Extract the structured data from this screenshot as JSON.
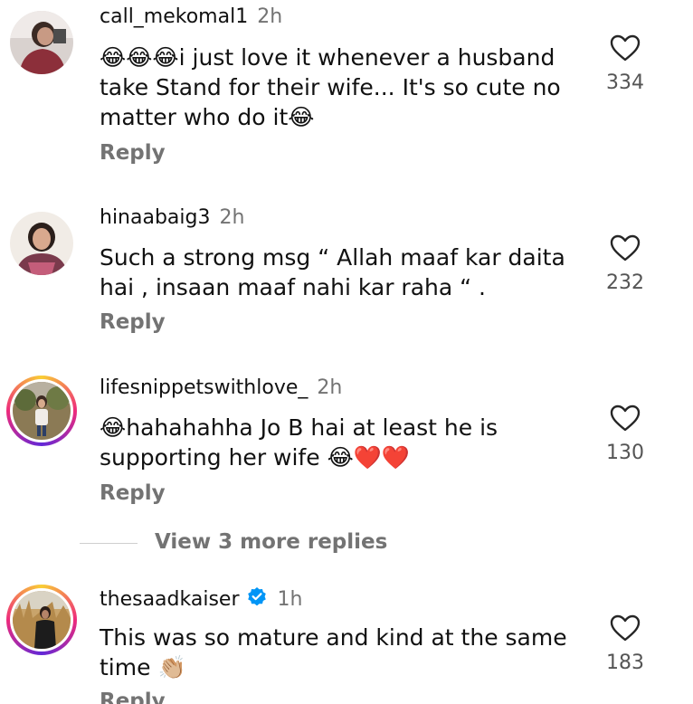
{
  "comments": [
    {
      "username": "call_mekomal1",
      "time": "2h",
      "text_emoji_prefix": "😂😂😂",
      "text": "i just love it whenever a husband take Stand for their wife... It's so cute no matter who do it",
      "text_emoji_suffix": "😂",
      "reply_label": "Reply",
      "likes": "334"
    },
    {
      "username": "hinaabaig3",
      "time": "2h",
      "text": "Such a strong msg “ Allah maaf kar daita hai , insaan maaf nahi kar raha “ .",
      "reply_label": "Reply",
      "likes": "232"
    },
    {
      "username": "lifesnippetswithlove_",
      "time": "2h",
      "text_emoji_prefix": "😂",
      "text": "hahahahha Jo B hai at least he is supporting her wife ",
      "text_emoji_suffix": "😂❤️❤️",
      "reply_label": "Reply",
      "likes": "130"
    },
    {
      "username": "thesaadkaiser",
      "time": "1h",
      "text": "This was so mature and kind at the same time ",
      "text_emoji_suffix": "👏🏼",
      "reply_label": "Reply",
      "likes": "183"
    }
  ],
  "view_more_replies": "View 3 more replies",
  "icons": {
    "like": "heart-outline-icon",
    "verified": "verified-badge-icon"
  },
  "colors": {
    "muted_text": "#737373",
    "verified_blue": "#0095f6",
    "heart_stroke": "#262626"
  }
}
